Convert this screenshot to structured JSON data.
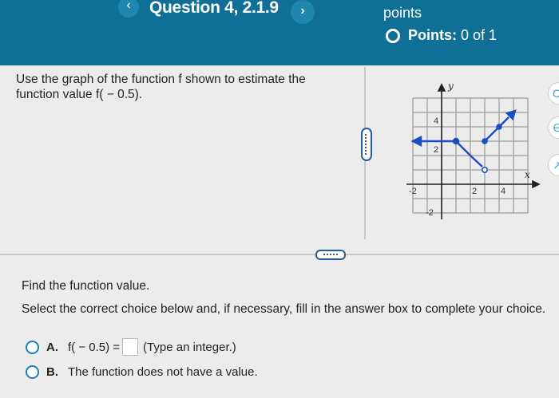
{
  "header": {
    "back_glyph": "‹",
    "question_title": "Question 4, 2.1.9",
    "next_glyph": "›",
    "points_label": "points",
    "points_status_label": "Points:",
    "points_status_value": "0 of 1"
  },
  "prompt": {
    "text": "Use the graph of the function f shown to estimate the function value f( − 0.5)."
  },
  "graph": {
    "y_axis_label": "y",
    "x_axis_label": "x",
    "x_ticks": [
      "-2",
      "2",
      "4"
    ],
    "y_ticks": [
      "4",
      "2",
      "-2"
    ],
    "colors": {
      "curve": "#1b4fbf",
      "axis": "#222222",
      "grid": "#9a9a9a"
    },
    "function_segments": [
      {
        "from": [
          -3,
          2
        ],
        "to": [
          0,
          2
        ],
        "left_arrow": true,
        "endpoint": "closed"
      },
      {
        "from": [
          0,
          2
        ],
        "to": [
          2,
          0
        ],
        "endpoint_right": "open"
      },
      {
        "from": [
          2,
          2
        ],
        "to": [
          4,
          4
        ],
        "right_arrow": true
      }
    ]
  },
  "question": {
    "find": "Find the function value.",
    "instruction": "Select the correct choice below and, if necessary, fill in the answer box to complete your choice."
  },
  "choices": [
    {
      "letter": "A.",
      "prefix": "f( − 0.5) =",
      "suffix": "(Type an integer.)"
    },
    {
      "letter": "B.",
      "text": "The function does not have a value."
    }
  ]
}
